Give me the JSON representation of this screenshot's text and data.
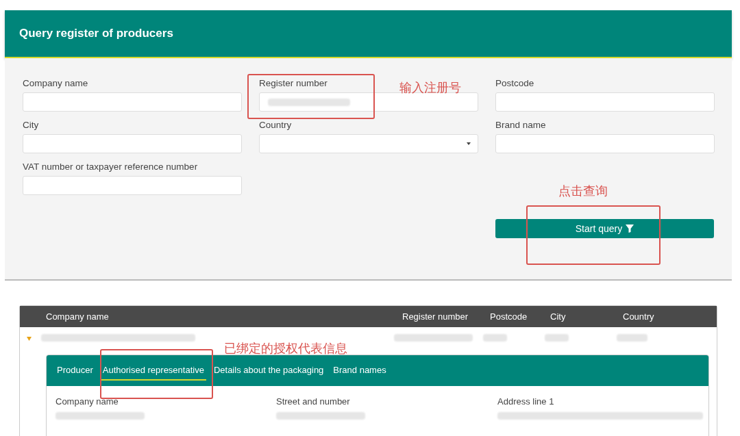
{
  "header": {
    "title": "Query register of producers"
  },
  "form": {
    "fields": [
      {
        "label": "Company name",
        "kind": "text"
      },
      {
        "label": "Register number",
        "kind": "text",
        "redacted_value": true
      },
      {
        "label": "Postcode",
        "kind": "text"
      },
      {
        "label": "City",
        "kind": "text"
      },
      {
        "label": "Country",
        "kind": "select"
      },
      {
        "label": "Brand name",
        "kind": "text"
      },
      {
        "label": "VAT number or taxpayer reference number",
        "kind": "text"
      }
    ],
    "button": "Start query"
  },
  "results": {
    "columns": [
      "Company name",
      "Register number",
      "Postcode",
      "City",
      "Country"
    ],
    "row": {
      "expanded": true
    },
    "tabs": [
      {
        "label": "Producer",
        "selected": false
      },
      {
        "label": "Authorised representative",
        "selected": true
      },
      {
        "label": "Details about the packaging",
        "selected": false
      },
      {
        "label": "Brand names",
        "selected": false
      }
    ],
    "detail_labels": [
      "Company name",
      "Street and number",
      "Address line 1"
    ]
  },
  "annotations": [
    {
      "text": "输入注册号"
    },
    {
      "text": "点击查询"
    },
    {
      "text": "已绑定的授权代表信息"
    }
  ]
}
